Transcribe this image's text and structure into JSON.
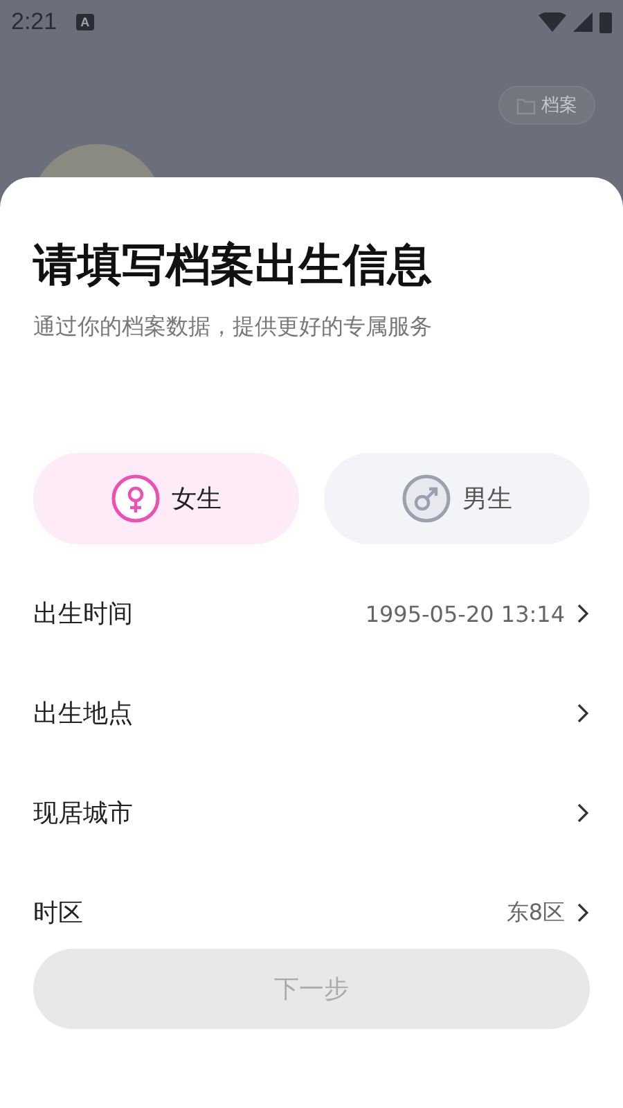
{
  "status_bar": {
    "time": "2:21",
    "notification": "A"
  },
  "background": {
    "archive_button": "档案"
  },
  "sheet": {
    "title": "请填写档案出生信息",
    "subtitle": "通过你的档案数据，提供更好的专属服务",
    "genders": [
      {
        "kind": "female",
        "label": "女生",
        "selected": true
      },
      {
        "kind": "male",
        "label": "男生",
        "selected": false
      }
    ],
    "rows": [
      {
        "label": "出生时间",
        "value": "1995-05-20 13:14"
      },
      {
        "label": "出生地点"
      },
      {
        "label": "现居城市"
      },
      {
        "label": "时区",
        "value": "东8区"
      }
    ],
    "next_button": {
      "label": "下一步",
      "disabled": true
    }
  }
}
